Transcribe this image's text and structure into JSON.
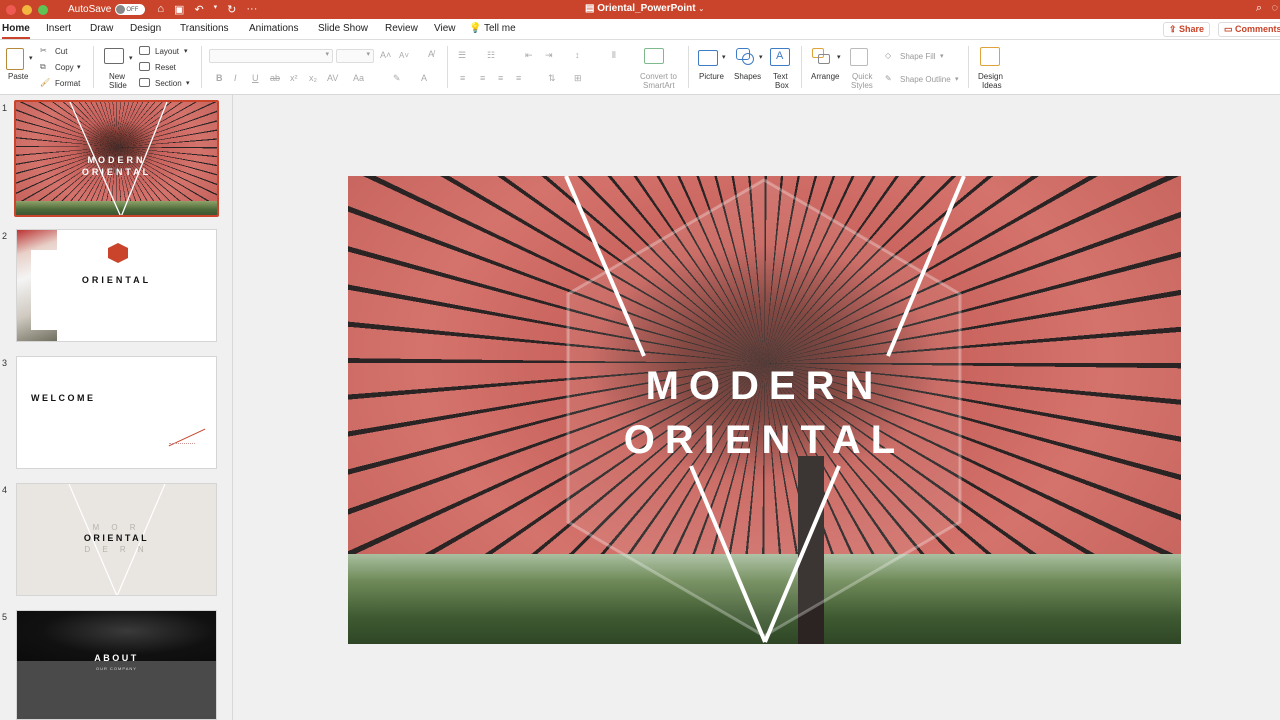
{
  "titlebar": {
    "autosave_label": "AutoSave",
    "autosave_state": "OFF",
    "document_title": "Oriental_PowerPoint"
  },
  "tabs": [
    "Home",
    "Insert",
    "Draw",
    "Design",
    "Transitions",
    "Animations",
    "Slide Show",
    "Review",
    "View",
    "Tell me"
  ],
  "actions": {
    "share": "Share",
    "comments": "Comments"
  },
  "ribbon": {
    "paste": "Paste",
    "cut": "Cut",
    "copy": "Copy",
    "format": "Format",
    "new_slide": [
      "New",
      "Slide"
    ],
    "layout": "Layout",
    "reset": "Reset",
    "section": "Section",
    "convert_smartart": [
      "Convert to",
      "SmartArt"
    ],
    "picture": "Picture",
    "shapes": "Shapes",
    "text_box": [
      "Text",
      "Box"
    ],
    "arrange": "Arrange",
    "quick_styles": [
      "Quick",
      "Styles"
    ],
    "shape_fill": "Shape Fill",
    "shape_outline": "Shape Outline",
    "design_ideas": [
      "Design",
      "Ideas"
    ]
  },
  "slides": [
    {
      "number": "1",
      "title_lines": [
        "MODERN",
        "ORIENTAL"
      ]
    },
    {
      "number": "2",
      "title": "ORIENTAL"
    },
    {
      "number": "3",
      "title": "WELCOME"
    },
    {
      "number": "4",
      "title_lines": [
        "M O R",
        "ORIENTAL",
        "D E R N"
      ]
    },
    {
      "number": "5",
      "title": "ABOUT",
      "subtitle": "OUR COMPANY"
    }
  ],
  "main_slide": {
    "line1": "MODERN",
    "line2": "ORIENTAL"
  },
  "colors": {
    "accent": "#c9442a",
    "umbrella": "#d4736c"
  }
}
